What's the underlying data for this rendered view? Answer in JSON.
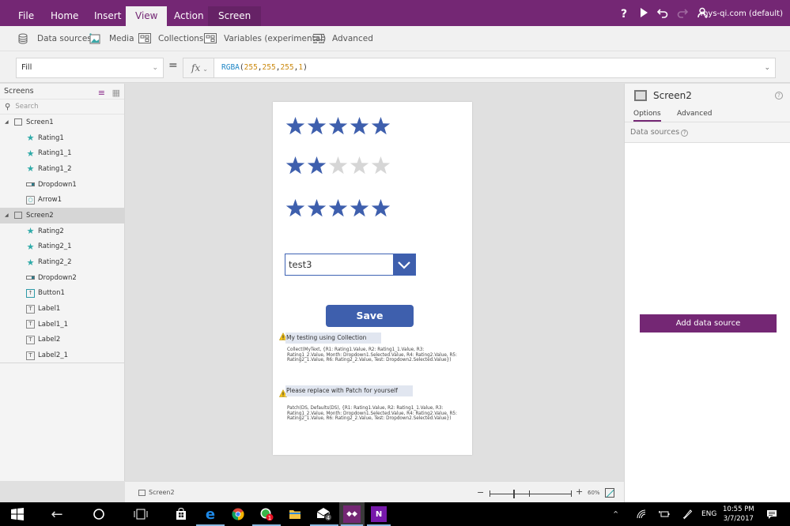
{
  "titlebar": {
    "tabs": [
      {
        "label": "File",
        "active": false
      },
      {
        "label": "Home",
        "active": false
      },
      {
        "label": "Insert",
        "active": false
      },
      {
        "label": "View",
        "active": true
      },
      {
        "label": "Action",
        "active": false
      },
      {
        "label": "Screen",
        "active": false,
        "contextual": true
      }
    ],
    "icons": [
      "help-icon",
      "play-icon",
      "undo-icon",
      "redo-icon",
      "share-user-icon"
    ],
    "help_glyph": "?",
    "account": "mys-qi.com (default)"
  },
  "ribbon": {
    "items": [
      {
        "label": "Data sources",
        "icon": "database-icon"
      },
      {
        "label": "Media",
        "icon": "media-icon"
      },
      {
        "label": "Collections",
        "icon": "collections-icon"
      },
      {
        "label": "Variables (experimental)",
        "icon": "variables-icon"
      },
      {
        "label": "Advanced",
        "icon": "advanced-icon"
      }
    ]
  },
  "formula_bar": {
    "property": "Fill",
    "equals": "=",
    "fx_label": "fx",
    "formula_fn": "RGBA",
    "formula_args": [
      "255",
      "255",
      "255",
      "1"
    ]
  },
  "tree": {
    "title": "Screens",
    "search_placeholder": "Search",
    "screens": [
      {
        "name": "Screen1",
        "selected": false,
        "controls": [
          {
            "name": "Rating1",
            "type": "rating"
          },
          {
            "name": "Rating1_1",
            "type": "rating"
          },
          {
            "name": "Rating1_2",
            "type": "rating"
          },
          {
            "name": "Dropdown1",
            "type": "dropdown"
          },
          {
            "name": "Arrow1",
            "type": "arrow"
          }
        ]
      },
      {
        "name": "Screen2",
        "selected": true,
        "controls": [
          {
            "name": "Rating2",
            "type": "rating"
          },
          {
            "name": "Rating2_1",
            "type": "rating"
          },
          {
            "name": "Rating2_2",
            "type": "rating"
          },
          {
            "name": "Dropdown2",
            "type": "dropdown"
          },
          {
            "name": "Button1",
            "type": "button"
          },
          {
            "name": "Label1",
            "type": "label"
          },
          {
            "name": "Label1_1",
            "type": "label"
          },
          {
            "name": "Label2",
            "type": "label"
          },
          {
            "name": "Label2_1",
            "type": "label"
          }
        ]
      }
    ]
  },
  "canvas": {
    "ratings": [
      {
        "value": 5,
        "max": 5
      },
      {
        "value": 2,
        "max": 5
      },
      {
        "value": 5,
        "max": 5
      }
    ],
    "colors": {
      "star_on": "#3e5fad",
      "star_off": "#d6d6d6",
      "accent": "#742774"
    },
    "dropdown_value": "test3",
    "save_label": "Save",
    "label1_title": "My testing using Collection",
    "label1_body": "Collect(MyText, {R1: Rating1.Value, R2: Rating1_1.Value, R3: Rating1_2.Value, Month: Dropdown1.Selected.Value, R4: Rating2.Value, R5: Rating2_1.Value, R6: Rating2_2.Value, Test: Dropdown2.Selected.Value})",
    "label2_title": "Please replace with Patch for yourself",
    "label2_body": "Patch(DS, Defaults(DS), {R1: Rating1.Value, R2: Rating1_1.Value, R3: Rating1_2.Value, Month: Dropdown1.Selected.Value, R4: Rating2.Value, R5: Rating2_1.Value, R6: Rating2_2.Value, Test: Dropdown2.Selected.Value})"
  },
  "right_panel": {
    "title": "Screen2",
    "tabs": [
      {
        "label": "Options",
        "active": true
      },
      {
        "label": "Advanced",
        "active": false
      }
    ],
    "section_label": "Data sources",
    "add_button": "Add data source"
  },
  "status_bar": {
    "screen_name": "Screen2",
    "zoom_minus": "−",
    "zoom_plus": "+",
    "zoom_level": "60%"
  },
  "taskbar": {
    "apps": [
      "start-icon",
      "back-icon",
      "cortana-icon",
      "task-view-icon",
      "store-icon",
      "edge-icon",
      "chrome-icon",
      "whatsapp-icon",
      "file-explorer-icon",
      "mail-icon",
      "powerapps-icon",
      "onenote-icon"
    ],
    "whatsapp_badge": "1",
    "mail_badge": "4",
    "language": "ENG",
    "time": "10:55 PM",
    "date": "3/7/2017"
  }
}
